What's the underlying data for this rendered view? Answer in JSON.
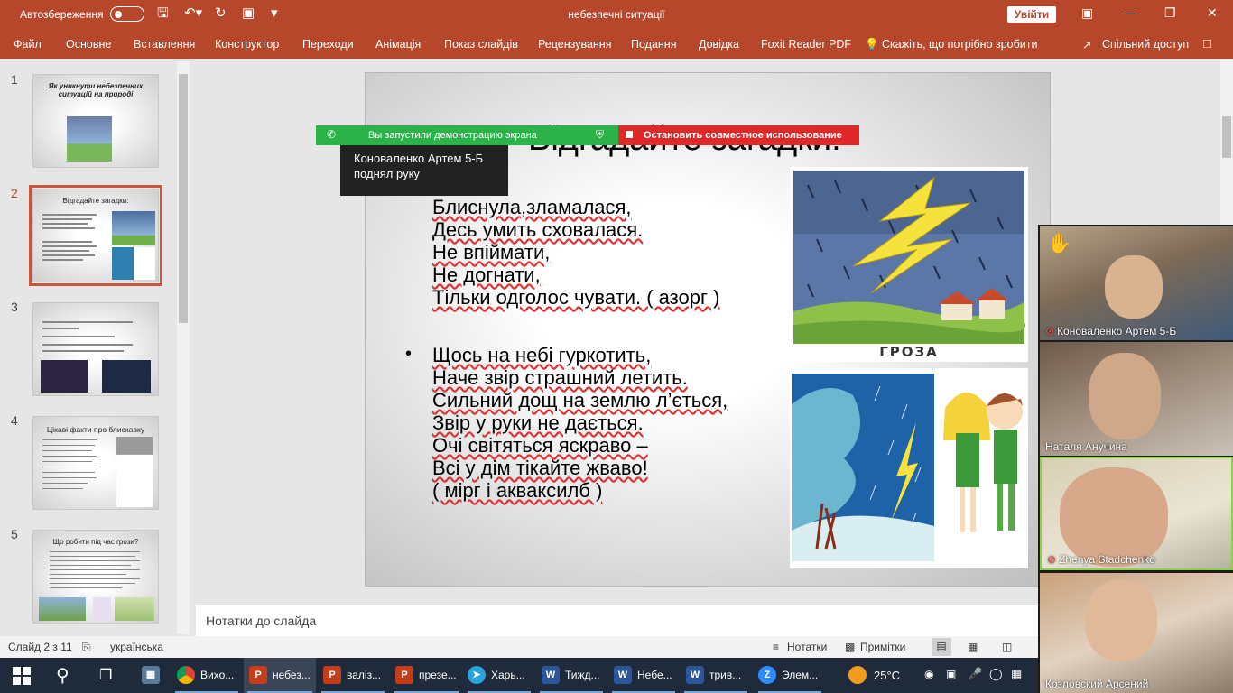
{
  "titlebar": {
    "autosave_label": "Автозбереження",
    "doc_title": "небезпечні ситуації",
    "signin_label": "Увійти"
  },
  "ribbon": {
    "tabs": [
      "Файл",
      "Основне",
      "Вставлення",
      "Конструктор",
      "Переходи",
      "Анімація",
      "Показ слайдів",
      "Рецензування",
      "Подання",
      "Довідка",
      "Foxit Reader PDF",
      "Скажіть, що потрібно зробити",
      "Спільний доступ"
    ]
  },
  "thumbnails": [
    {
      "num": "1",
      "title": "Як уникнути небезпечних ситуацій         на     природі"
    },
    {
      "num": "2",
      "title": "Відгадайте загадки:"
    },
    {
      "num": "3",
      "title": ""
    },
    {
      "num": "4",
      "title": "Цікаві факти про блискавку"
    },
    {
      "num": "5",
      "title": "Що робити під час грози?"
    }
  ],
  "slide": {
    "title": "Відгадайте загадки:",
    "riddle1": [
      "Блиснула,зламалася,",
      "Десь умить сховалася.",
      "Не впіймати,",
      "Не догнати,",
      "Тільки одголос чувати. ( азорг )"
    ],
    "riddle2": [
      "Щось на небі гуркотить,",
      "Наче звір страшний летить.",
      "Сильний дощ на землю л’ється,",
      "Звір у руки не дається.",
      "Очі світяться яскраво –",
      "Всі у дім тікайте жваво!",
      "( мірг і акваксилб )"
    ],
    "pic1_caption": "ГРОЗА"
  },
  "notes_placeholder": "Нотатки до слайда",
  "status": {
    "slide_counter": "Слайд 2 з 11",
    "language": "українська",
    "notes_btn": "Нотатки",
    "comments_btn": "Примітки"
  },
  "zoom": {
    "share_banner": "Вы запустили демонстрацию экрана",
    "stop_share": "Остановить совместное использование",
    "tooltip": "Коноваленко Артем 5-Б поднял руку",
    "participants": [
      {
        "name": "Коноваленко Артем 5-Б",
        "muted": true
      },
      {
        "name": "Наталя Анучина",
        "muted": false
      },
      {
        "name": "Zhenya Stadchenko",
        "muted": true
      },
      {
        "name": "Козловский Арсений",
        "muted": false
      }
    ]
  },
  "taskbar": {
    "items": [
      "Вихо...",
      "небез...",
      "валіз...",
      "презе...",
      "Харь...",
      "Тижд...",
      "Небе...",
      "трив...",
      "Элем..."
    ],
    "temperature": "25°C"
  }
}
